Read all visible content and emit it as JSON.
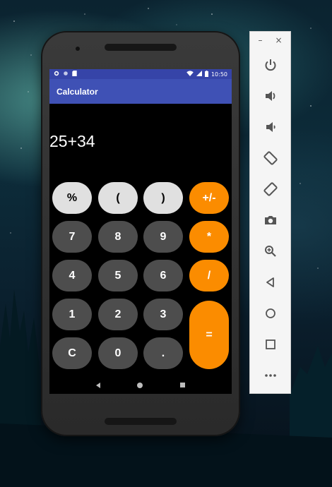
{
  "status_bar": {
    "time": "10:50"
  },
  "app": {
    "title": "Calculator"
  },
  "display": {
    "expression": "25+34"
  },
  "keypad": {
    "percent": "%",
    "open_paren": "(",
    "close_paren": ")",
    "plus_minus": "+/-",
    "seven": "7",
    "eight": "8",
    "nine": "9",
    "multiply": "*",
    "four": "4",
    "five": "5",
    "six": "6",
    "divide": "/",
    "one": "1",
    "two": "2",
    "three": "3",
    "equals": "=",
    "clear": "C",
    "zero": "0",
    "decimal": "."
  },
  "emulator": {
    "minimize": "–",
    "close": "×",
    "tools": [
      "power-icon",
      "volume-up-icon",
      "volume-down-icon",
      "rotate-left-icon",
      "rotate-right-icon",
      "camera-icon",
      "zoom-icon",
      "back-icon",
      "home-icon",
      "overview-icon",
      "more-icon"
    ]
  },
  "colors": {
    "primary": "#3f51b5",
    "primary_dark": "#3644a8",
    "operator": "#fb8c00",
    "function_key": "#e0e0e0",
    "digit_key": "#4d4d4d"
  }
}
